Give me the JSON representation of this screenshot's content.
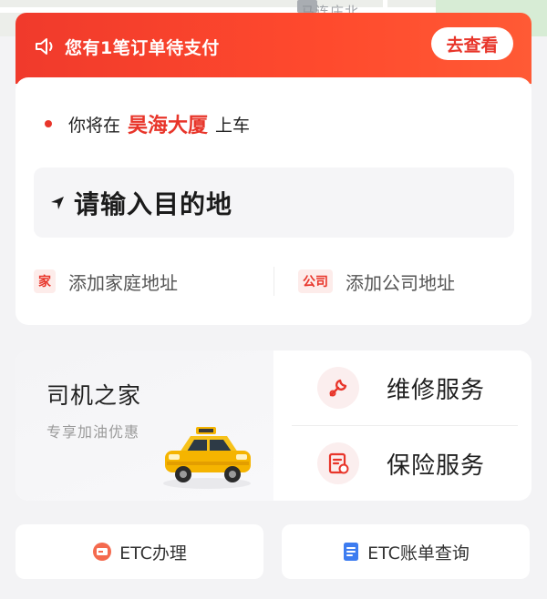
{
  "map": {
    "label": "马连庄北"
  },
  "banner": {
    "message": "您有1笔订单待支付",
    "action": "去查看"
  },
  "pickup": {
    "prefix": "你将在",
    "place": "昊海大厦",
    "suffix": "上车"
  },
  "destination": {
    "placeholder": "请输入目的地"
  },
  "quick": {
    "home": {
      "tag": "家",
      "label": "添加家庭地址"
    },
    "work": {
      "tag": "公司",
      "label": "添加公司地址"
    }
  },
  "driver": {
    "title": "司机之家",
    "subtitle": "专享加油优惠",
    "services": [
      {
        "label": "维修服务",
        "icon": "wrench-icon"
      },
      {
        "label": "保险服务",
        "icon": "insurance-document-icon"
      }
    ]
  },
  "etc": {
    "apply": "ETC办理",
    "bill": "ETC账单查询"
  },
  "colors": {
    "accent": "#e8352a",
    "banner": "#f03a2c"
  }
}
